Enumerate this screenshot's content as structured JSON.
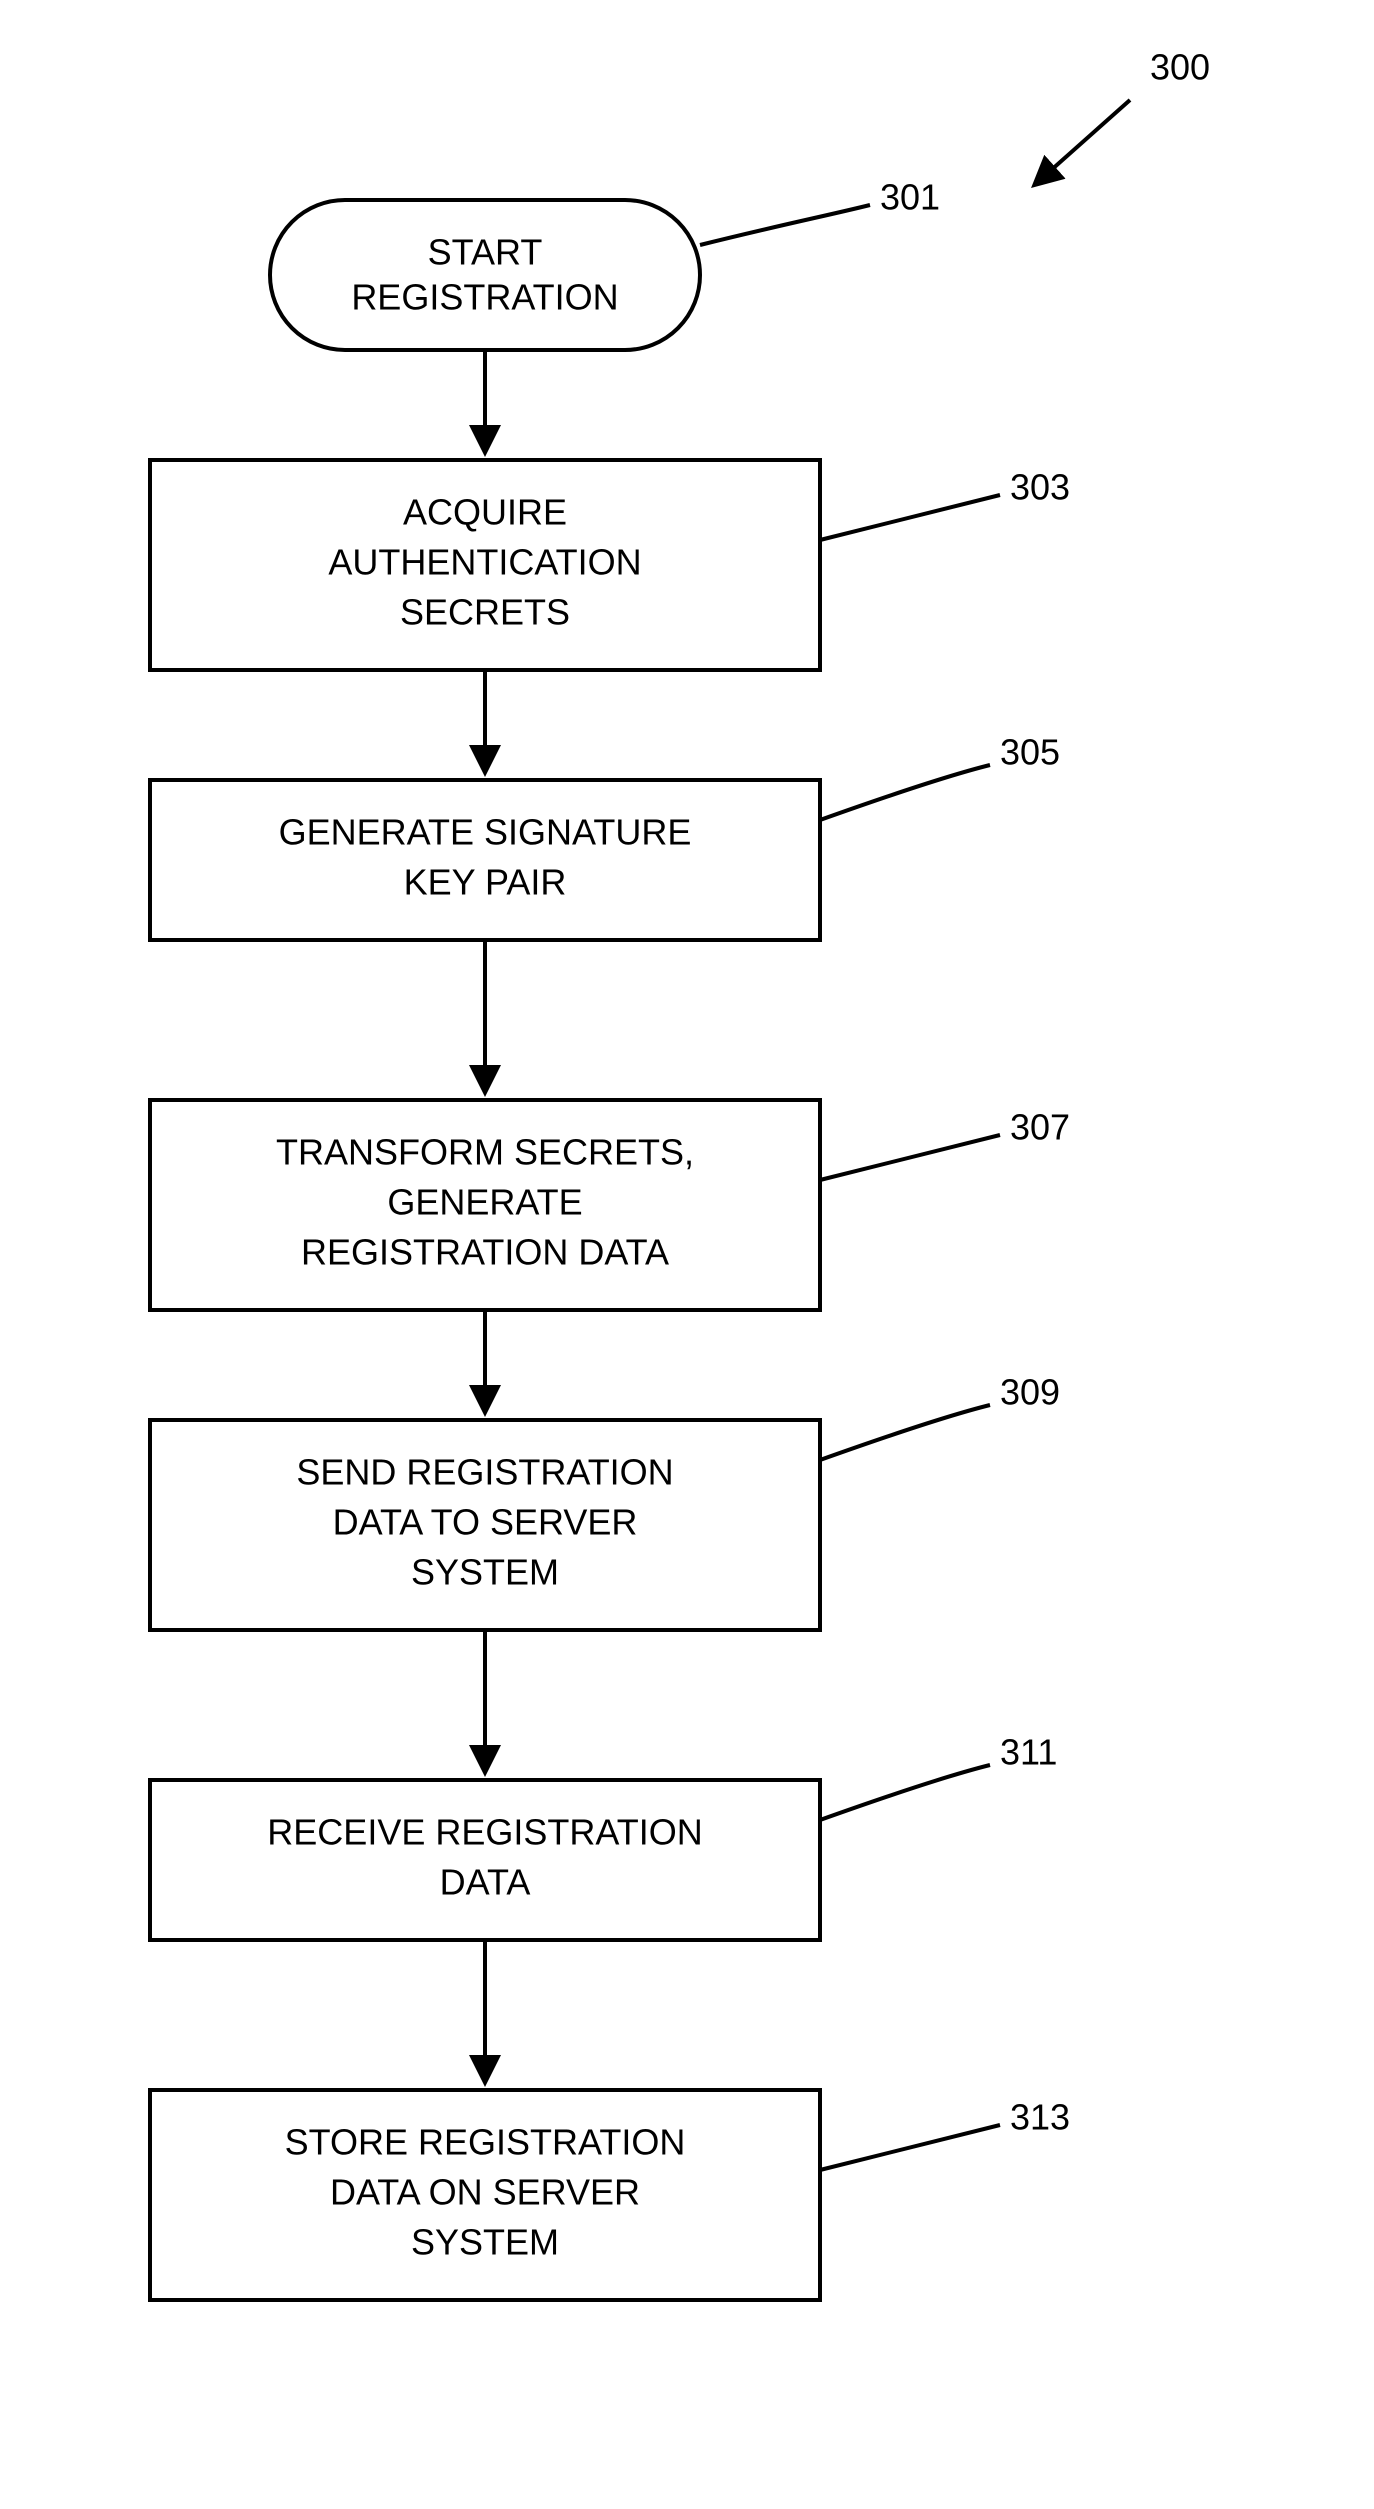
{
  "diagram": {
    "ref": "300",
    "start": {
      "ref": "301",
      "line1": "START",
      "line2": "REGISTRATION"
    },
    "steps": [
      {
        "ref": "303",
        "lines": [
          "ACQUIRE",
          "AUTHENTICATION",
          "SECRETS"
        ]
      },
      {
        "ref": "305",
        "lines": [
          "GENERATE SIGNATURE",
          "KEY PAIR"
        ]
      },
      {
        "ref": "307",
        "lines": [
          "TRANSFORM SECRETS,",
          "GENERATE",
          "REGISTRATION DATA"
        ]
      },
      {
        "ref": "309",
        "lines": [
          "SEND REGISTRATION",
          "DATA TO SERVER",
          "SYSTEM"
        ]
      },
      {
        "ref": "311",
        "lines": [
          "RECEIVE REGISTRATION",
          "DATA"
        ]
      },
      {
        "ref": "313",
        "lines": [
          "STORE REGISTRATION",
          "DATA ON SERVER",
          "SYSTEM"
        ]
      }
    ]
  }
}
